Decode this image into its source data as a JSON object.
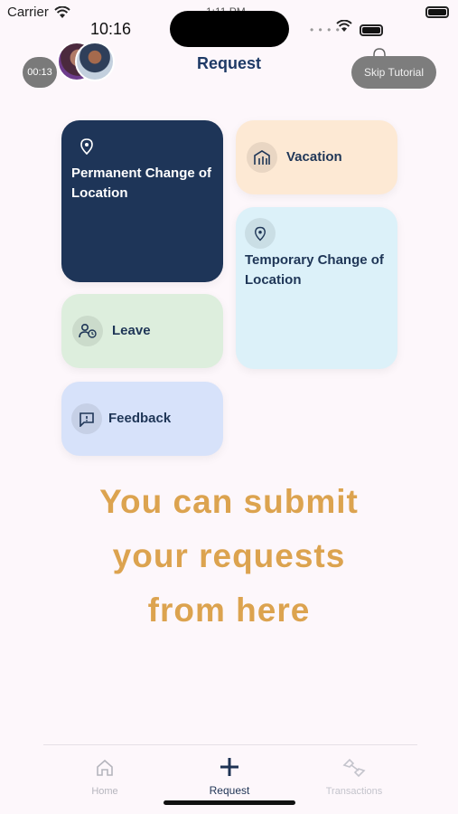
{
  "status": {
    "carrier": "Carrier",
    "time": "10:16",
    "behind_time": "1:11 PM"
  },
  "header": {
    "timer": "00:13",
    "title": "Request",
    "skip_label": "Skip Tutorial"
  },
  "cards": {
    "pcl": "Permanent Change of Location",
    "vacation": "Vacation",
    "tcl": "Temporary Change of Location",
    "leave": "Leave",
    "feedback": "Feedback"
  },
  "tutorial": {
    "line1": "You can submit",
    "line2": "your requests",
    "line3": "from here"
  },
  "nav": {
    "home": "Home",
    "request": "Request",
    "transactions": "Transactions"
  },
  "colors": {
    "navy": "#1e3558",
    "accent_text": "#dca34f",
    "vacation_bg": "#fde9d4",
    "tcl_bg": "#dcf1f9",
    "leave_bg": "#ddeedd",
    "feedback_bg": "#d7e2fa"
  }
}
